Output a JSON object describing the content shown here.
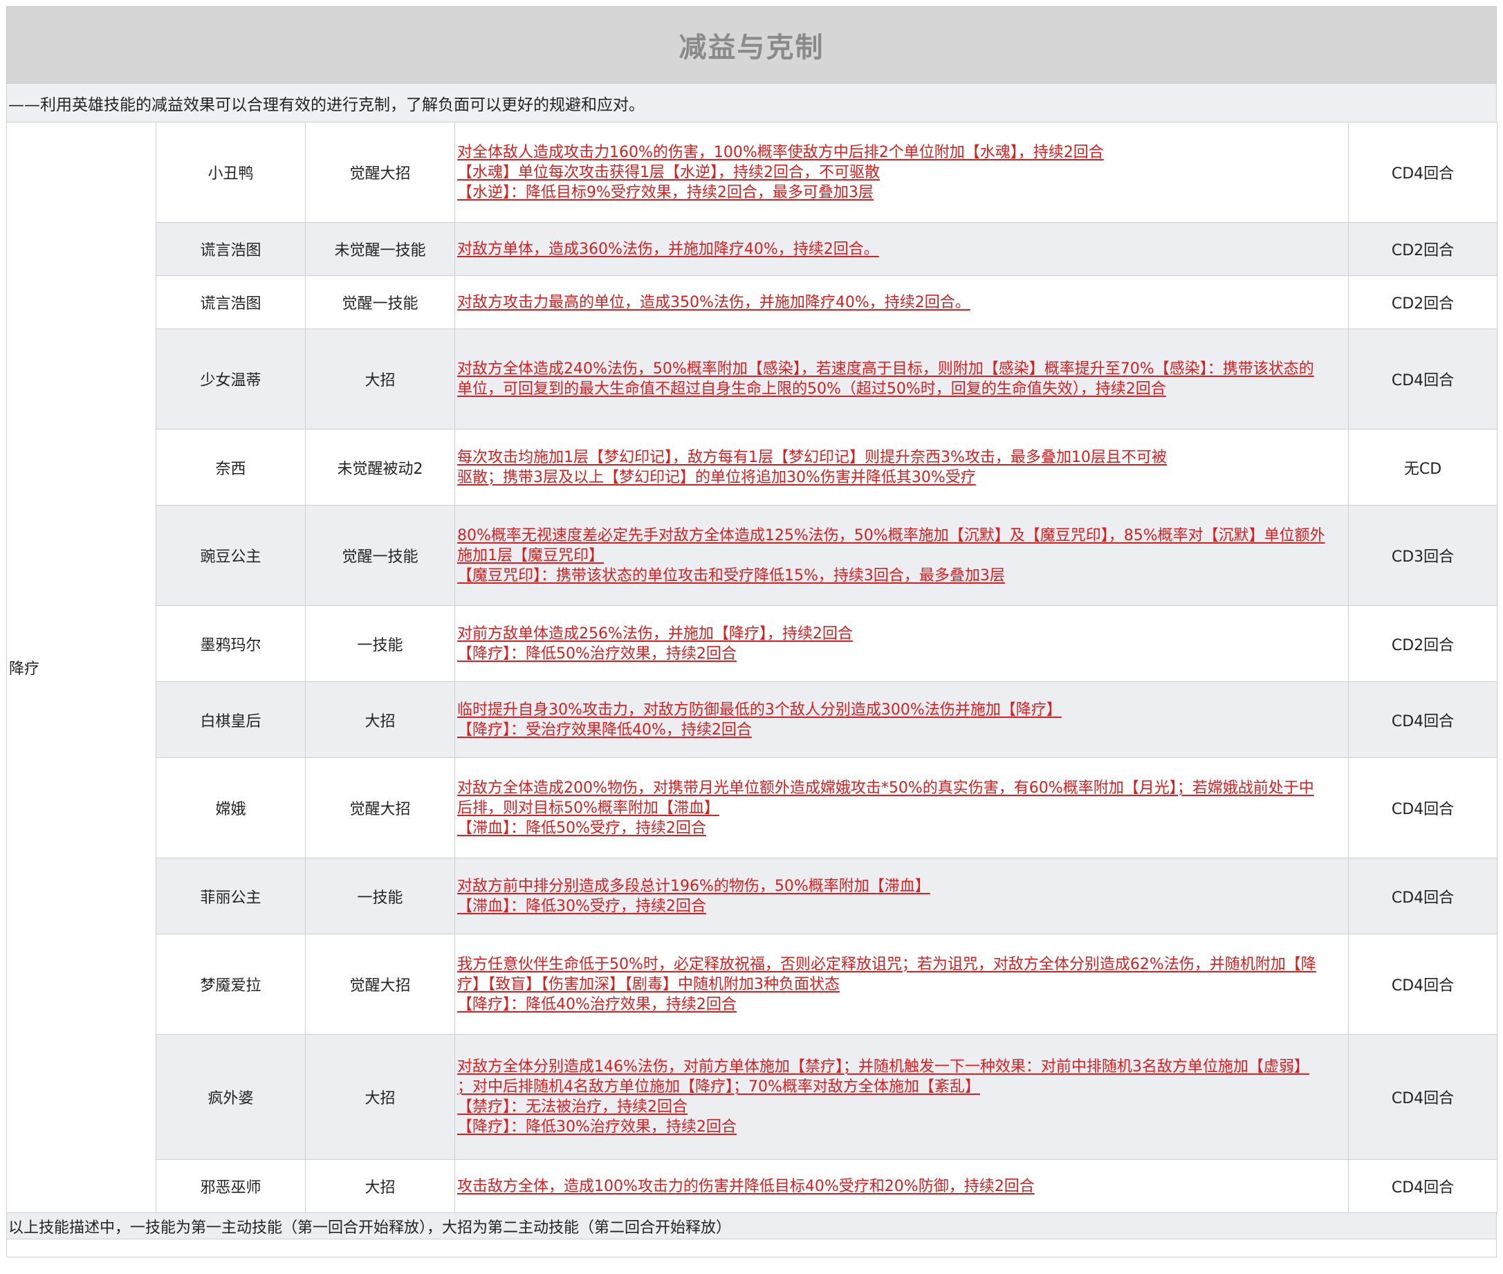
{
  "title": "减益与克制",
  "subtitle": "——利用英雄技能的减益效果可以合理有效的进行克制，了解负面可以更好的规避和应对。",
  "category": "降疗",
  "rows": [
    {
      "hero": "小丑鸭",
      "skill": "觉醒大招",
      "desc": [
        "对全体敌人造成攻击力160%的伤害，100%概率使敌方中后排2个单位附加【水魂】，持续2回合",
        "【水魂】单位每次攻击获得1层【水逆】，持续2回合，不可驱散",
        "【水逆】：降低目标9%受疗效果，持续2回合，最多可叠加3层"
      ],
      "cd": "CD4回合"
    },
    {
      "hero": "谎言浩图",
      "skill": "未觉醒一技能",
      "desc": [
        "对敌方单体，造成360%法伤，并施加降疗40%，持续2回合。"
      ],
      "cd": "CD2回合"
    },
    {
      "hero": "谎言浩图",
      "skill": "觉醒一技能",
      "desc": [
        "对敌方攻击力最高的单位，造成350%法伤，并施加降疗40%，持续2回合。"
      ],
      "cd": "CD2回合"
    },
    {
      "hero": "少女温蒂",
      "skill": "大招",
      "desc": [
        "对敌方全体造成240%法伤，50%概率附加【感染】，若速度高于目标，则附加【感染】概率提升至70%【感染】：携带该状态的",
        "单位，可回复到的最大生命值不超过自身生命上限的50%（超过50%时，回复的生命值失效），持续2回合"
      ],
      "cd": "CD4回合"
    },
    {
      "hero": "奈西",
      "skill": "未觉醒被动2",
      "desc": [
        "每次攻击均施加1层【梦幻印记】，敌方每有1层【梦幻印记】则提升奈西3%攻击，最多叠加10层且不可被",
        "驱散；携带3层及以上【梦幻印记】的单位将追加30%伤害并降低其30%受疗"
      ],
      "cd": "无CD"
    },
    {
      "hero": "豌豆公主",
      "skill": "觉醒一技能",
      "desc": [
        "80%概率无视速度差必定先手对敌方全体造成125%法伤，50%概率施加【沉默】及【魔豆咒印】，85%概率对【沉默】单位额外",
        "施加1层【魔豆咒印】",
        "【魔豆咒印】：携带该状态的单位攻击和受疗降低15%，持续3回合，最多叠加3层"
      ],
      "cd": "CD3回合"
    },
    {
      "hero": "墨鸦玛尔",
      "skill": "一技能",
      "desc": [
        "对前方敌单体造成256%法伤，并施加【降疗】，持续2回合",
        "【降疗】：降低50%治疗效果，持续2回合"
      ],
      "cd": "CD2回合"
    },
    {
      "hero": "白棋皇后",
      "skill": "大招",
      "desc": [
        "临时提升自身30%攻击力，对敌方防御最低的3个敌人分别造成300%法伤并施加【降疗】",
        "【降疗】：受治疗效果降低40%，持续2回合"
      ],
      "cd": "CD4回合"
    },
    {
      "hero": "嫦娥",
      "skill": "觉醒大招",
      "desc": [
        "对敌方全体造成200%物伤，对携带月光单位额外造成嫦娥攻击*50%的真实伤害，有60%概率附加【月光】；若嫦娥战前处于中",
        "后排，则对目标50%概率附加【滞血】",
        "【滞血】：降低50%受疗，持续2回合"
      ],
      "cd": "CD4回合"
    },
    {
      "hero": "菲丽公主",
      "skill": "一技能",
      "desc": [
        "对敌方前中排分别造成多段总计196%的物伤，50%概率附加【滞血】",
        "【滞血】：降低30%受疗，持续2回合"
      ],
      "cd": "CD4回合"
    },
    {
      "hero": "梦魇爱拉",
      "skill": "觉醒大招",
      "desc": [
        "我方任意伙伴生命低于50%时，必定释放祝福，否则必定释放诅咒；若为诅咒，对敌方全体分别造成62%法伤，并随机附加【降",
        "疗】【致盲】【伤害加深】【剧毒】中随机附加3种负面状态",
        "【降疗】：降低40%治疗效果，持续2回合"
      ],
      "cd": "CD4回合"
    },
    {
      "hero": "疯外婆",
      "skill": "大招",
      "desc": [
        "对敌方全体分别造成146%法伤，对前方单体施加【禁疗】；并随机触发一下一种效果：对前中排随机3名敌方单位施加【虚弱】",
        "；对中后排随机4名敌方单位施加【降疗】；70%概率对敌方全体施加【紊乱】",
        "【禁疗】：无法被治疗，持续2回合",
        "【降疗】：降低30%治疗效果，持续2回合"
      ],
      "cd": "CD4回合"
    },
    {
      "hero": "邪恶巫师",
      "skill": "大招",
      "desc": [
        "攻击敌方全体，造成100%攻击力的伤害并降低目标40%受疗和20%防御，持续2回合"
      ],
      "cd": "CD4回合"
    }
  ],
  "footer": "以上技能描述中，一技能为第一主动技能（第一回合开始释放），大招为第二主动技能（第二回合开始释放）"
}
